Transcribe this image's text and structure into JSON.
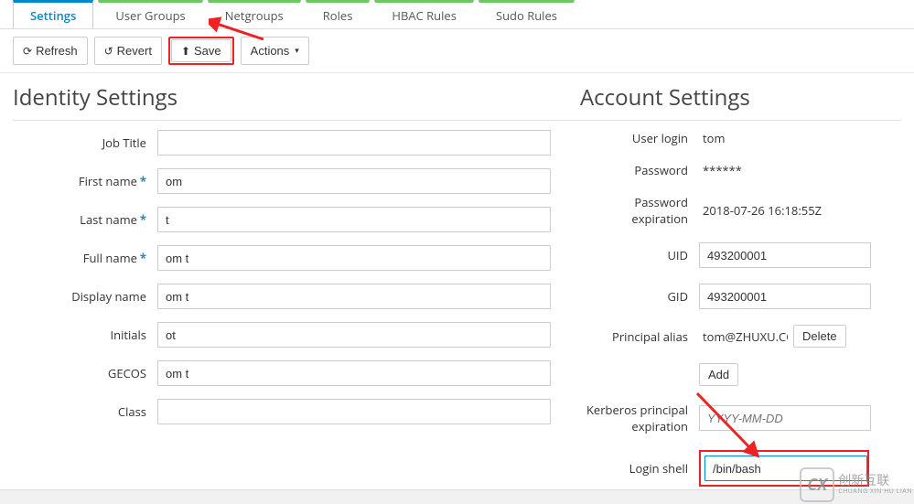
{
  "tabs": {
    "settings": "Settings",
    "user_groups": "User Groups",
    "netgroups": "Netgroups",
    "roles": "Roles",
    "hbac_rules": "HBAC Rules",
    "sudo_rules": "Sudo Rules"
  },
  "toolbar": {
    "refresh": "Refresh",
    "revert": "Revert",
    "save": "Save",
    "actions": "Actions"
  },
  "identity": {
    "title": "Identity Settings",
    "labels": {
      "job_title": "Job Title",
      "first_name": "First name",
      "last_name": "Last name",
      "full_name": "Full name",
      "display_name": "Display name",
      "initials": "Initials",
      "gecos": "GECOS",
      "class": "Class"
    },
    "values": {
      "job_title": "",
      "first_name": "om",
      "last_name": "t",
      "full_name": "om t",
      "display_name": "om t",
      "initials": "ot",
      "gecos": "om t",
      "class": ""
    }
  },
  "account": {
    "title": "Account Settings",
    "labels": {
      "user_login": "User login",
      "password": "Password",
      "password_expiration": "Password expiration",
      "uid": "UID",
      "gid": "GID",
      "principal_alias": "Principal alias",
      "kerberos_principal_expiration": "Kerberos principal expiration",
      "login_shell": "Login shell",
      "delete": "Delete",
      "add": "Add"
    },
    "values": {
      "user_login": "tom",
      "password": "******",
      "password_expiration": "2018-07-26 16:18:55Z",
      "uid": "493200001",
      "gid": "493200001",
      "principal_alias": "tom@ZHUXU.CO",
      "kerberos_placeholder": "YYYY-MM-DD",
      "login_shell": "/bin/bash"
    }
  },
  "watermark": {
    "brand": "创新互联",
    "sub": "CHUANG XIN HU LIAN"
  }
}
